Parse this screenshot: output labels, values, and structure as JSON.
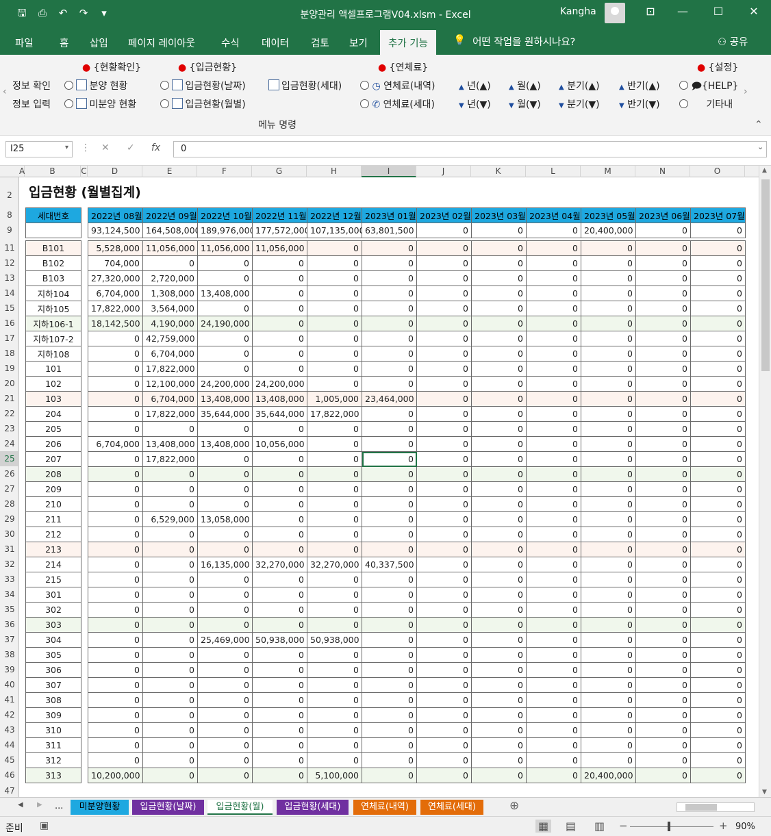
{
  "window": {
    "doc_title": "분양관리 액셀프로그램V04.xlsm  -  Excel",
    "user": "Kangha"
  },
  "ribbon_tabs": [
    "파일",
    "홈",
    "삽입",
    "페이지 레이아웃",
    "수식",
    "데이터",
    "검토",
    "보기",
    "추가 기능"
  ],
  "tell_me": "어떤 작업을 원하시나요?",
  "share": "공유",
  "ribbon": {
    "g1": "{현황확인}",
    "g2": "{입금현황}",
    "g3": "{연체료}",
    "g4": "{설정}",
    "r1a": "정보 확인",
    "r1b": "정보 입력",
    "b_sale": "분양 현황",
    "b_unsold": "미분양 현황",
    "b_dep_date": "입금현황(날짜)",
    "b_dep_month": "입금현황(월별)",
    "b_dep_house": "입금현황(세대)",
    "b_late_list": "연체료(내역)",
    "b_late_house": "연체료(세대)",
    "up_year": "년(▲)",
    "up_month": "월(▲)",
    "up_q": "분기(▲)",
    "up_half": "반기(▲)",
    "dn_year": "년(▼)",
    "dn_month": "월(▼)",
    "dn_q": "분기(▼)",
    "dn_half": "반기(▼)",
    "help": "{HELP}",
    "other": "기타내",
    "group_label": "메뉴 명령"
  },
  "formula_bar": {
    "cell": "I25",
    "value": "0"
  },
  "columns": [
    "A",
    "B",
    "C",
    "D",
    "E",
    "F",
    "G",
    "H",
    "I",
    "J",
    "K",
    "L",
    "M",
    "N",
    "O"
  ],
  "sheet": {
    "title": "입금현황 (월별집계)",
    "header_label": "세대번호",
    "months": [
      "2022년 08월",
      "2022년 09월",
      "2022년 10월",
      "2022년 11월",
      "2022년 12월",
      "2023년 01월",
      "2023년 02월",
      "2023년 03월",
      "2023년 04월",
      "2023년 05월",
      "2023년 06월",
      "2023년 07월"
    ],
    "totals": [
      "93,124,500",
      "164,508,000",
      "189,976,000",
      "177,572,000",
      "107,135,000",
      "63,801,500",
      "0",
      "0",
      "0",
      "20,400,000",
      "0",
      "0"
    ],
    "rows": [
      {
        "r": "11",
        "unit": "B101",
        "v": [
          "5,528,000",
          "11,056,000",
          "11,056,000",
          "11,056,000",
          "0",
          "0",
          "0",
          "0",
          "0",
          "0",
          "0",
          "0"
        ]
      },
      {
        "r": "12",
        "unit": "B102",
        "v": [
          "704,000",
          "0",
          "0",
          "0",
          "0",
          "0",
          "0",
          "0",
          "0",
          "0",
          "0",
          "0"
        ]
      },
      {
        "r": "13",
        "unit": "B103",
        "v": [
          "27,320,000",
          "2,720,000",
          "0",
          "0",
          "0",
          "0",
          "0",
          "0",
          "0",
          "0",
          "0",
          "0"
        ]
      },
      {
        "r": "14",
        "unit": "지하104",
        "v": [
          "6,704,000",
          "1,308,000",
          "13,408,000",
          "0",
          "0",
          "0",
          "0",
          "0",
          "0",
          "0",
          "0",
          "0"
        ]
      },
      {
        "r": "15",
        "unit": "지하105",
        "v": [
          "17,822,000",
          "3,564,000",
          "0",
          "0",
          "0",
          "0",
          "0",
          "0",
          "0",
          "0",
          "0",
          "0"
        ]
      },
      {
        "r": "16",
        "unit": "지하106-1",
        "v": [
          "18,142,500",
          "4,190,000",
          "24,190,000",
          "0",
          "0",
          "0",
          "0",
          "0",
          "0",
          "0",
          "0",
          "0"
        ]
      },
      {
        "r": "17",
        "unit": "지하107-2",
        "v": [
          "0",
          "42,759,000",
          "0",
          "0",
          "0",
          "0",
          "0",
          "0",
          "0",
          "0",
          "0",
          "0"
        ]
      },
      {
        "r": "18",
        "unit": "지하108",
        "v": [
          "0",
          "6,704,000",
          "0",
          "0",
          "0",
          "0",
          "0",
          "0",
          "0",
          "0",
          "0",
          "0"
        ]
      },
      {
        "r": "19",
        "unit": "101",
        "v": [
          "0",
          "17,822,000",
          "0",
          "0",
          "0",
          "0",
          "0",
          "0",
          "0",
          "0",
          "0",
          "0"
        ]
      },
      {
        "r": "20",
        "unit": "102",
        "v": [
          "0",
          "12,100,000",
          "24,200,000",
          "24,200,000",
          "0",
          "0",
          "0",
          "0",
          "0",
          "0",
          "0",
          "0"
        ]
      },
      {
        "r": "21",
        "unit": "103",
        "v": [
          "0",
          "6,704,000",
          "13,408,000",
          "13,408,000",
          "1,005,000",
          "23,464,000",
          "0",
          "0",
          "0",
          "0",
          "0",
          "0"
        ]
      },
      {
        "r": "22",
        "unit": "204",
        "v": [
          "0",
          "17,822,000",
          "35,644,000",
          "35,644,000",
          "17,822,000",
          "0",
          "0",
          "0",
          "0",
          "0",
          "0",
          "0"
        ]
      },
      {
        "r": "23",
        "unit": "205",
        "v": [
          "0",
          "0",
          "0",
          "0",
          "0",
          "0",
          "0",
          "0",
          "0",
          "0",
          "0",
          "0"
        ]
      },
      {
        "r": "24",
        "unit": "206",
        "v": [
          "6,704,000",
          "13,408,000",
          "13,408,000",
          "10,056,000",
          "0",
          "0",
          "0",
          "0",
          "0",
          "0",
          "0",
          "0"
        ]
      },
      {
        "r": "25",
        "unit": "207",
        "v": [
          "0",
          "17,822,000",
          "0",
          "0",
          "0",
          "0",
          "0",
          "0",
          "0",
          "0",
          "0",
          "0"
        ]
      },
      {
        "r": "26",
        "unit": "208",
        "v": [
          "0",
          "0",
          "0",
          "0",
          "0",
          "0",
          "0",
          "0",
          "0",
          "0",
          "0",
          "0"
        ]
      },
      {
        "r": "27",
        "unit": "209",
        "v": [
          "0",
          "0",
          "0",
          "0",
          "0",
          "0",
          "0",
          "0",
          "0",
          "0",
          "0",
          "0"
        ]
      },
      {
        "r": "28",
        "unit": "210",
        "v": [
          "0",
          "0",
          "0",
          "0",
          "0",
          "0",
          "0",
          "0",
          "0",
          "0",
          "0",
          "0"
        ]
      },
      {
        "r": "29",
        "unit": "211",
        "v": [
          "0",
          "6,529,000",
          "13,058,000",
          "0",
          "0",
          "0",
          "0",
          "0",
          "0",
          "0",
          "0",
          "0"
        ]
      },
      {
        "r": "30",
        "unit": "212",
        "v": [
          "0",
          "0",
          "0",
          "0",
          "0",
          "0",
          "0",
          "0",
          "0",
          "0",
          "0",
          "0"
        ]
      },
      {
        "r": "31",
        "unit": "213",
        "v": [
          "0",
          "0",
          "0",
          "0",
          "0",
          "0",
          "0",
          "0",
          "0",
          "0",
          "0",
          "0"
        ]
      },
      {
        "r": "32",
        "unit": "214",
        "v": [
          "0",
          "0",
          "16,135,000",
          "32,270,000",
          "32,270,000",
          "40,337,500",
          "0",
          "0",
          "0",
          "0",
          "0",
          "0"
        ]
      },
      {
        "r": "33",
        "unit": "215",
        "v": [
          "0",
          "0",
          "0",
          "0",
          "0",
          "0",
          "0",
          "0",
          "0",
          "0",
          "0",
          "0"
        ]
      },
      {
        "r": "34",
        "unit": "301",
        "v": [
          "0",
          "0",
          "0",
          "0",
          "0",
          "0",
          "0",
          "0",
          "0",
          "0",
          "0",
          "0"
        ]
      },
      {
        "r": "35",
        "unit": "302",
        "v": [
          "0",
          "0",
          "0",
          "0",
          "0",
          "0",
          "0",
          "0",
          "0",
          "0",
          "0",
          "0"
        ]
      },
      {
        "r": "36",
        "unit": "303",
        "v": [
          "0",
          "0",
          "0",
          "0",
          "0",
          "0",
          "0",
          "0",
          "0",
          "0",
          "0",
          "0"
        ]
      },
      {
        "r": "37",
        "unit": "304",
        "v": [
          "0",
          "0",
          "25,469,000",
          "50,938,000",
          "50,938,000",
          "0",
          "0",
          "0",
          "0",
          "0",
          "0",
          "0"
        ]
      },
      {
        "r": "38",
        "unit": "305",
        "v": [
          "0",
          "0",
          "0",
          "0",
          "0",
          "0",
          "0",
          "0",
          "0",
          "0",
          "0",
          "0"
        ]
      },
      {
        "r": "39",
        "unit": "306",
        "v": [
          "0",
          "0",
          "0",
          "0",
          "0",
          "0",
          "0",
          "0",
          "0",
          "0",
          "0",
          "0"
        ]
      },
      {
        "r": "40",
        "unit": "307",
        "v": [
          "0",
          "0",
          "0",
          "0",
          "0",
          "0",
          "0",
          "0",
          "0",
          "0",
          "0",
          "0"
        ]
      },
      {
        "r": "41",
        "unit": "308",
        "v": [
          "0",
          "0",
          "0",
          "0",
          "0",
          "0",
          "0",
          "0",
          "0",
          "0",
          "0",
          "0"
        ]
      },
      {
        "r": "42",
        "unit": "309",
        "v": [
          "0",
          "0",
          "0",
          "0",
          "0",
          "0",
          "0",
          "0",
          "0",
          "0",
          "0",
          "0"
        ]
      },
      {
        "r": "43",
        "unit": "310",
        "v": [
          "0",
          "0",
          "0",
          "0",
          "0",
          "0",
          "0",
          "0",
          "0",
          "0",
          "0",
          "0"
        ]
      },
      {
        "r": "44",
        "unit": "311",
        "v": [
          "0",
          "0",
          "0",
          "0",
          "0",
          "0",
          "0",
          "0",
          "0",
          "0",
          "0",
          "0"
        ]
      },
      {
        "r": "45",
        "unit": "312",
        "v": [
          "0",
          "0",
          "0",
          "0",
          "0",
          "0",
          "0",
          "0",
          "0",
          "0",
          "0",
          "0"
        ]
      },
      {
        "r": "46",
        "unit": "313",
        "v": [
          "10,200,000",
          "0",
          "0",
          "0",
          "5,100,000",
          "0",
          "0",
          "0",
          "0",
          "20,400,000",
          "0",
          "0"
        ]
      }
    ]
  },
  "sheet_tabs": [
    {
      "label": "미분양현황",
      "color": "#1ea8e0",
      "fg": "#000000"
    },
    {
      "label": "입금현황(날짜)",
      "color": "#7030a0",
      "fg": "#ffffff"
    },
    {
      "label": "입금현황(월)",
      "color": "#ffffff",
      "fg": "#217346"
    },
    {
      "label": "입금현황(세대)",
      "color": "#7030a0",
      "fg": "#ffffff"
    },
    {
      "label": "연체료(내역)",
      "color": "#e36c09",
      "fg": "#ffffff"
    },
    {
      "label": "연체료(세대)",
      "color": "#e36c09",
      "fg": "#ffffff"
    }
  ],
  "tabs_ellipsis": "...",
  "status": {
    "ready": "준비",
    "zoom": "90%"
  }
}
